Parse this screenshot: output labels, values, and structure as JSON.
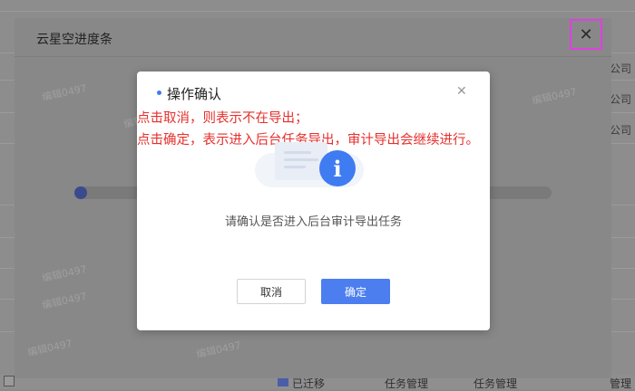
{
  "background": {
    "right_texts": [
      "公司",
      "公司",
      "公司"
    ],
    "bottom_items": [
      "已迁移",
      "任务管理",
      "任务管理",
      "管理"
    ]
  },
  "outer_dialog": {
    "title": "云星空进度条",
    "close_glyph": "✕",
    "watermarks": [
      "编辑0497",
      "编辑0497",
      "编辑0497",
      "编辑0497",
      "编辑0497",
      "编辑0497",
      "编辑0497"
    ]
  },
  "confirm_modal": {
    "title": "操作确认",
    "close_glyph": "✕",
    "icon_glyph": "i",
    "message": "请确认是否进入后台审计导出任务",
    "cancel_label": "取消",
    "ok_label": "确定"
  },
  "annotations": {
    "line1": "点击取消，则表示不在导出；",
    "line2": "点击确定，表示进入后台任务导出，审计导出会继续进行。",
    "color": "#e5302c"
  },
  "colors": {
    "accent": "#4c7ef0",
    "highlight_border": "#e040e0"
  }
}
